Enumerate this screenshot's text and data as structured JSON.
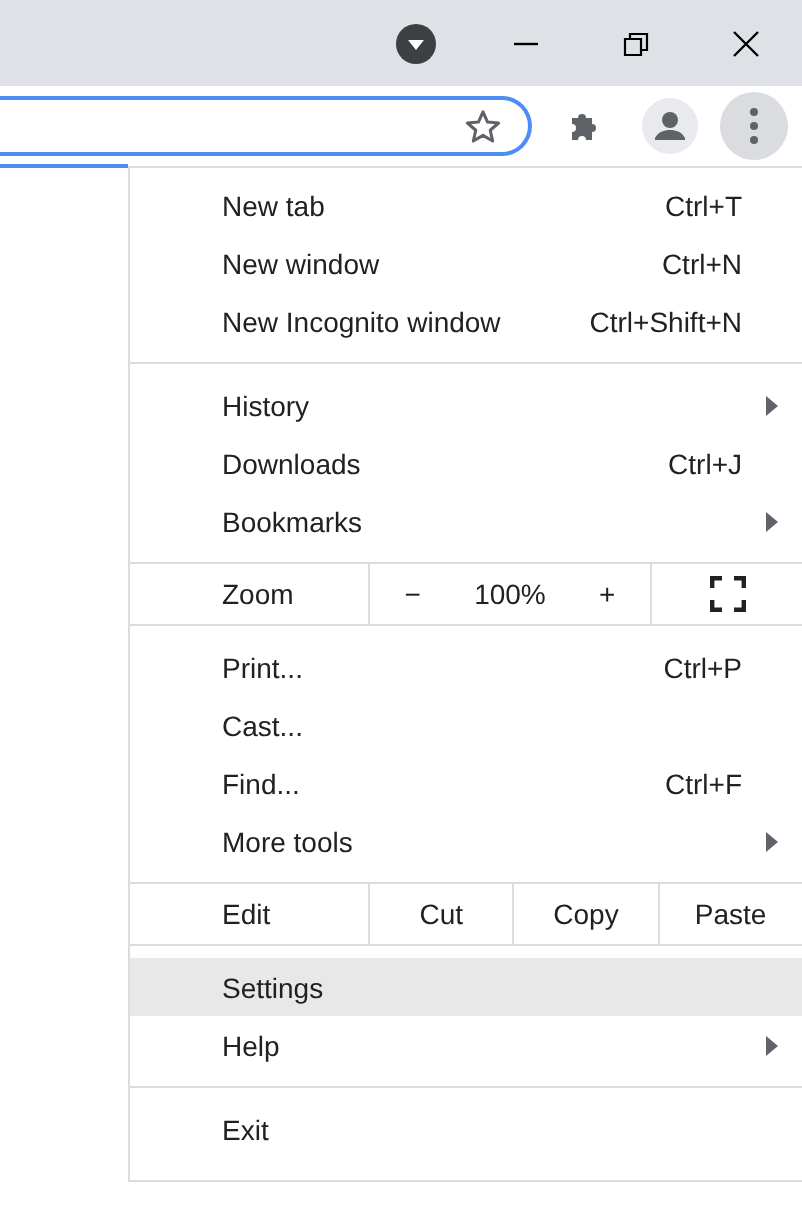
{
  "menu": {
    "sections": [
      {
        "items": [
          {
            "kind": "item",
            "label": "New tab",
            "shortcut": "Ctrl+T",
            "submenu": false,
            "selected": false
          },
          {
            "kind": "item",
            "label": "New window",
            "shortcut": "Ctrl+N",
            "submenu": false,
            "selected": false
          },
          {
            "kind": "item",
            "label": "New Incognito window",
            "shortcut": "Ctrl+Shift+N",
            "submenu": false,
            "selected": false
          }
        ]
      },
      {
        "items": [
          {
            "kind": "item",
            "label": "History",
            "submenu": true,
            "selected": false
          },
          {
            "kind": "item",
            "label": "Downloads",
            "shortcut": "Ctrl+J",
            "submenu": false,
            "selected": false
          },
          {
            "kind": "item",
            "label": "Bookmarks",
            "submenu": true,
            "selected": false
          }
        ]
      },
      {
        "items": [
          {
            "kind": "zoom",
            "label": "Zoom",
            "minus": "−",
            "value": "100%",
            "plus": "+"
          }
        ]
      },
      {
        "items": [
          {
            "kind": "item",
            "label": "Print...",
            "shortcut": "Ctrl+P",
            "submenu": false,
            "selected": false
          },
          {
            "kind": "item",
            "label": "Cast...",
            "submenu": false,
            "selected": false
          },
          {
            "kind": "item",
            "label": "Find...",
            "shortcut": "Ctrl+F",
            "submenu": false,
            "selected": false
          },
          {
            "kind": "item",
            "label": "More tools",
            "submenu": true,
            "selected": false
          }
        ]
      },
      {
        "items": [
          {
            "kind": "edit",
            "label": "Edit",
            "actions": [
              "Cut",
              "Copy",
              "Paste"
            ]
          }
        ]
      },
      {
        "items": [
          {
            "kind": "item",
            "label": "Settings",
            "submenu": false,
            "selected": true
          },
          {
            "kind": "item",
            "label": "Help",
            "submenu": true,
            "selected": false
          }
        ]
      },
      {
        "items": [
          {
            "kind": "item",
            "label": "Exit",
            "submenu": false,
            "selected": false
          }
        ]
      }
    ]
  }
}
